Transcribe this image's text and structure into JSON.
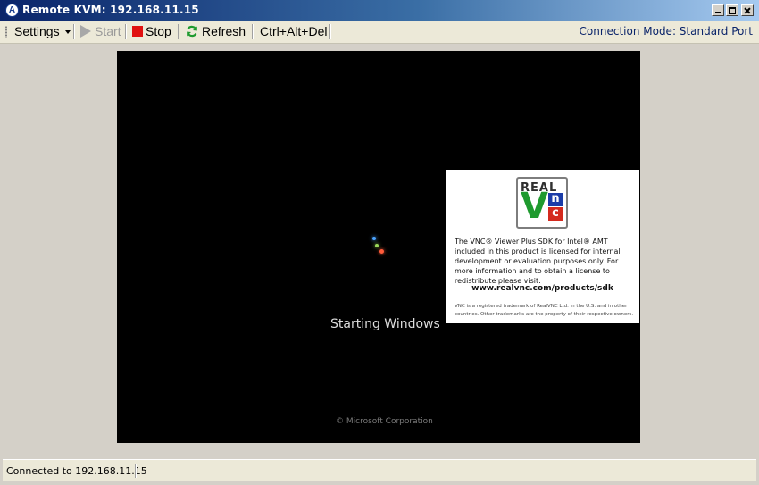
{
  "window": {
    "title": "Remote KVM: 192.168.11.15",
    "app_icon": "intel-amt-icon",
    "controls": [
      "minimize",
      "maximize",
      "close"
    ]
  },
  "toolbar": {
    "settings_label": "Settings",
    "start_label": "Start",
    "stop_label": "Stop",
    "refresh_label": "Refresh",
    "cad_label": "Ctrl+Alt+Del",
    "connection_mode": "Connection Mode: Standard Port",
    "icons": {
      "start": "play-icon",
      "stop": "stop-icon",
      "refresh": "refresh-icon"
    },
    "colors": {
      "stop": "#e01010",
      "refresh": "#1e9a2e",
      "start_disabled": "#a8a8a8"
    }
  },
  "remote_screen": {
    "boot_text": "Starting Windows",
    "copyright": "© Microsoft Corporation",
    "background": "#000000"
  },
  "vnc_notice": {
    "logo_top": "REAL",
    "logo_v": "V",
    "logo_n": "n",
    "logo_c": "c",
    "body": "The VNC® Viewer Plus SDK for Intel® AMT included in this product is licensed for internal development or evaluation purposes only.  For more information and to obtain a license to redistribute please visit:",
    "url": "www.realvnc.com/products/sdk",
    "trademark": "VNC is a registered trademark of RealVNC Ltd. in the U.S. and in other countries. Other trademarks are the property of their respective owners."
  },
  "status": {
    "text": "Connected to 192.168.11.15"
  }
}
